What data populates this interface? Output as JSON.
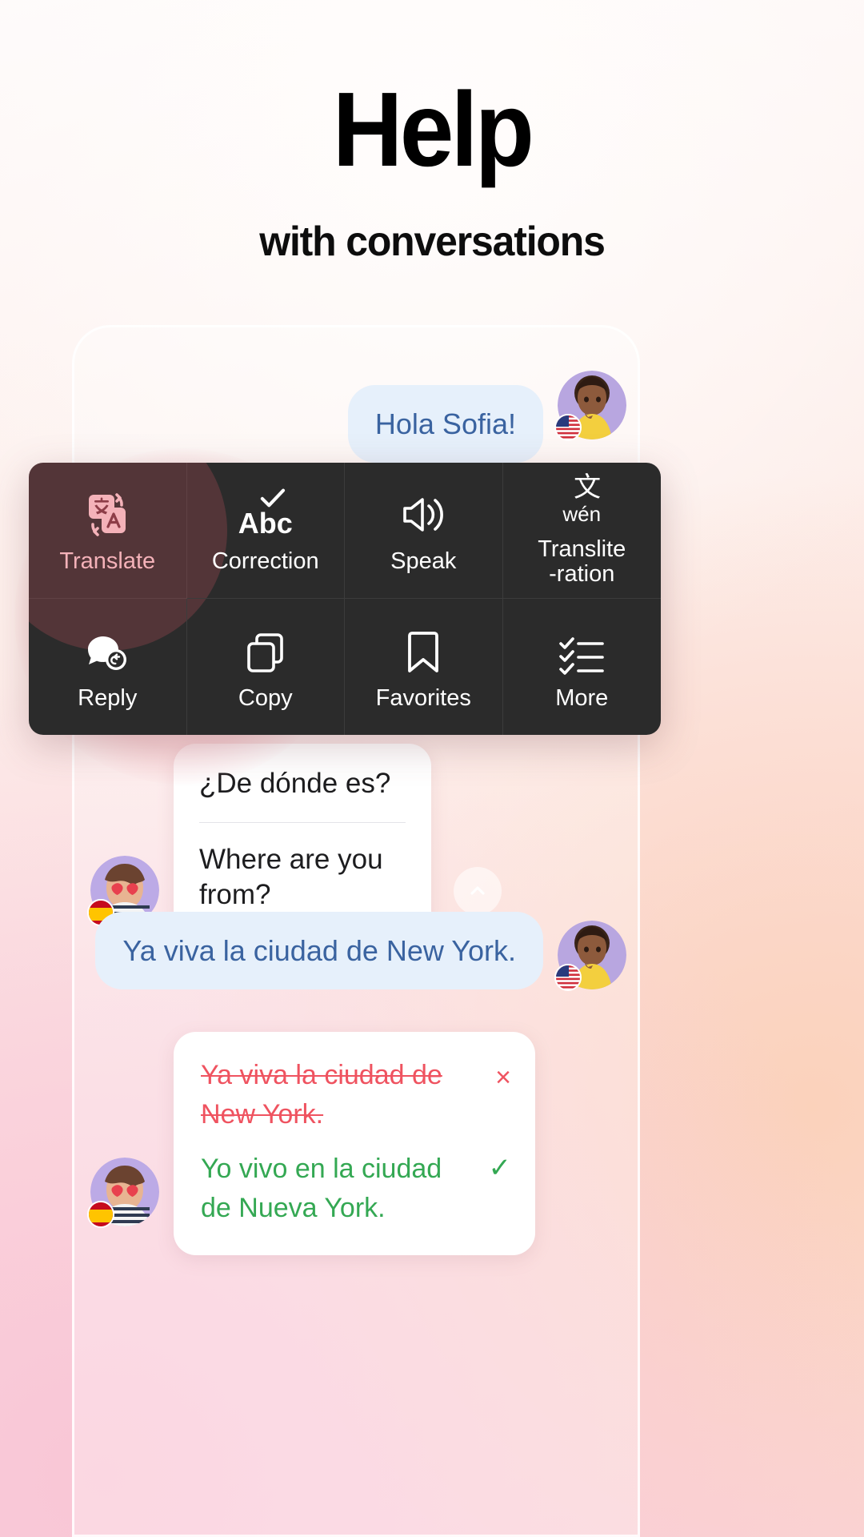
{
  "header": {
    "title": "Help",
    "subtitle": "with conversations"
  },
  "colors": {
    "menu_bg": "#2b2b2b",
    "active_accent": "#f4b2b9",
    "bubble_blue_bg": "#e6f0fb",
    "bubble_blue_text": "#3a63a0",
    "error_red": "#ef5360",
    "correct_green": "#34a853"
  },
  "chat": {
    "messages": [
      {
        "id": "m1",
        "side": "right",
        "text": "Hola Sofia!",
        "flag": "us-flag"
      },
      {
        "id": "m2",
        "side": "left",
        "source": "¿De dónde es?",
        "translation": "Where are you from?",
        "flag": "es-flag"
      },
      {
        "id": "m3",
        "side": "right",
        "text": "Ya viva la ciudad de New York.",
        "flag": "us-flag"
      },
      {
        "id": "m4",
        "side": "left",
        "flag": "es-flag",
        "wrong": "Ya viva la ciudad de New York.",
        "corrected": "Yo vivo en la ciudad de Nueva York.",
        "wrong_mark": "×",
        "corrected_mark": "✓"
      }
    ],
    "collapse_icon": "chevron-up-icon"
  },
  "action_menu": {
    "rows": [
      [
        {
          "label": "Translate",
          "icon": "translate-icon",
          "active": true
        },
        {
          "label": "Correction",
          "icon": "check-abc-icon",
          "active": false
        },
        {
          "label": "Speak",
          "icon": "speaker-icon",
          "active": false
        },
        {
          "label": "Translite\n-ration",
          "icon": "transliteration-icon",
          "active": false,
          "glyph_top": "文",
          "glyph_bottom": "wén"
        }
      ],
      [
        {
          "label": "Reply",
          "icon": "reply-bubble-icon",
          "active": false
        },
        {
          "label": "Copy",
          "icon": "copy-icon",
          "active": false
        },
        {
          "label": "Favorites",
          "icon": "bookmark-icon",
          "active": false
        },
        {
          "label": "More",
          "icon": "checklist-icon",
          "active": false
        }
      ]
    ],
    "correction_glyph": "Abc"
  }
}
